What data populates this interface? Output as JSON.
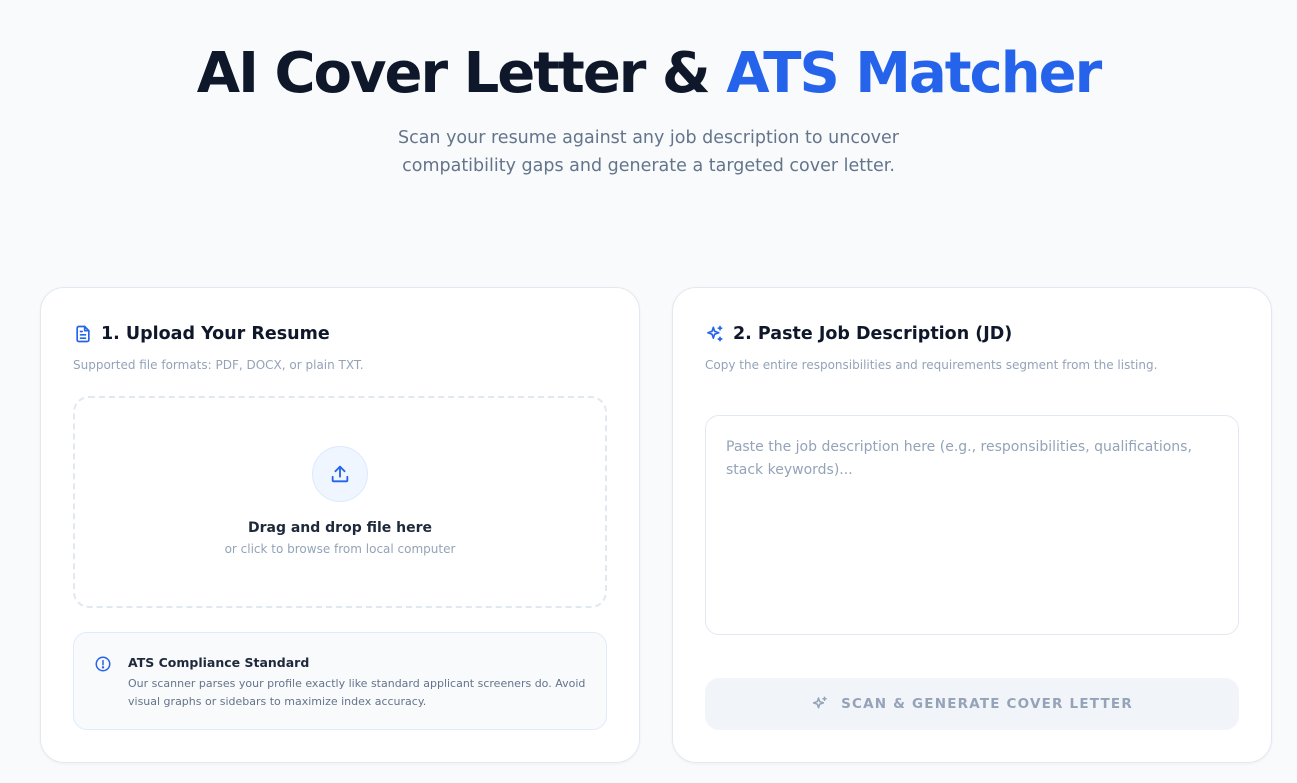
{
  "hero": {
    "title_main": "AI Cover Letter & ",
    "title_accent": "ATS Matcher",
    "subtitle": "Scan your resume against any job description to uncover compatibility gaps and generate a targeted cover letter."
  },
  "upload": {
    "title": "1. Upload Your Resume",
    "subtitle": "Supported file formats: PDF, DOCX, or plain TXT.",
    "icon": "document-icon",
    "drop_title": "Drag and drop file here",
    "drop_subtitle": "or click to browse from local computer",
    "notice_title": "ATS Compliance Standard",
    "notice_body": "Our scanner parses your profile exactly like standard applicant screeners do. Avoid visual graphs or sidebars to maximize index accuracy."
  },
  "jd": {
    "title": "2. Paste Job Description (JD)",
    "subtitle": "Copy the entire responsibilities and requirements segment from the listing.",
    "icon": "sparkles-icon",
    "value": "",
    "placeholder": "Paste the job description here (e.g., responsibilities, qualifications, stack keywords)...",
    "button_label": "SCAN & GENERATE COVER LETTER"
  },
  "colors": {
    "accent": "#2563eb",
    "text": "#0f172a",
    "muted": "#64748b",
    "disabled": "#94a3b8"
  }
}
